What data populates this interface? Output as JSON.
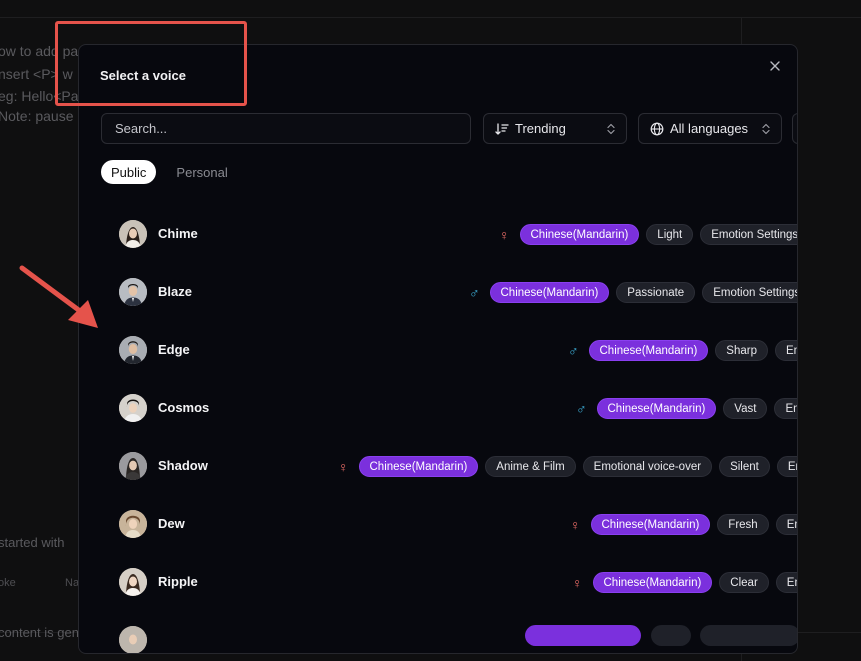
{
  "background": {
    "lines": [
      "ow to add pa",
      "nsert <P> w",
      "eg: Hello<Pa",
      "Note: pause"
    ],
    "started_text": "started with",
    "chip_1": "oke",
    "chip_2": "Na",
    "footer_text": "content is gen"
  },
  "modal": {
    "title": "Select a voice",
    "search_placeholder": "Search...",
    "sort_label": "Trending",
    "language_label": "All languages",
    "tabs": [
      {
        "label": "Public",
        "active": true
      },
      {
        "label": "Personal",
        "active": false
      }
    ]
  },
  "voices": [
    {
      "name": "Chime",
      "gender": "♀",
      "language": "Chinese(Mandarin)",
      "tags": [
        "Light",
        "Emotion Settings"
      ]
    },
    {
      "name": "Blaze",
      "gender": "♂",
      "language": "Chinese(Mandarin)",
      "tags": [
        "Passionate",
        "Emotion Settings"
      ]
    },
    {
      "name": "Edge",
      "gender": "♂",
      "language": "Chinese(Mandarin)",
      "tags": [
        "Sharp",
        "Em"
      ]
    },
    {
      "name": "Cosmos",
      "gender": "♂",
      "language": "Chinese(Mandarin)",
      "tags": [
        "Vast",
        "Em"
      ]
    },
    {
      "name": "Shadow",
      "gender": "♀",
      "language": "Chinese(Mandarin)",
      "tags": [
        "Anime & Film",
        "Emotional voice-over",
        "Silent",
        "Em"
      ]
    },
    {
      "name": "Dew",
      "gender": "♀",
      "language": "Chinese(Mandarin)",
      "tags": [
        "Fresh",
        "Em"
      ]
    },
    {
      "name": "Ripple",
      "gender": "♀",
      "language": "Chinese(Mandarin)",
      "tags": [
        "Clear",
        "Em"
      ]
    }
  ],
  "colors": {
    "female": "#f0706a",
    "male": "#3fb5e0",
    "language_tag": "#7b30dd",
    "annotation": "#e5534b"
  }
}
